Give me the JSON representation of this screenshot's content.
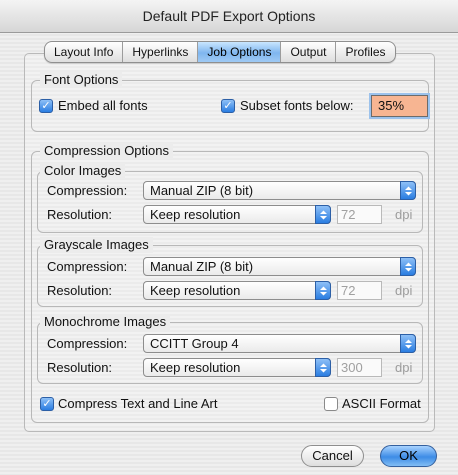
{
  "window": {
    "title": "Default PDF Export Options"
  },
  "tabs": [
    {
      "label": "Layout Info",
      "active": false
    },
    {
      "label": "Hyperlinks",
      "active": false
    },
    {
      "label": "Job Options",
      "active": true
    },
    {
      "label": "Output",
      "active": false
    },
    {
      "label": "Profiles",
      "active": false
    }
  ],
  "font_options": {
    "legend": "Font Options",
    "embed_label": "Embed all fonts",
    "embed_checked": true,
    "subset_label": "Subset fonts below:",
    "subset_checked": true,
    "subset_value": "35%"
  },
  "compression_options": {
    "legend": "Compression Options",
    "color": {
      "legend": "Color Images",
      "compression_label": "Compression:",
      "compression_value": "Manual ZIP (8 bit)",
      "resolution_label": "Resolution:",
      "resolution_value": "Keep resolution",
      "dpi_value": "72",
      "dpi_unit": "dpi"
    },
    "grayscale": {
      "legend": "Grayscale Images",
      "compression_label": "Compression:",
      "compression_value": "Manual ZIP (8 bit)",
      "resolution_label": "Resolution:",
      "resolution_value": "Keep resolution",
      "dpi_value": "72",
      "dpi_unit": "dpi"
    },
    "monochrome": {
      "legend": "Monochrome Images",
      "compression_label": "Compression:",
      "compression_value": "CCITT Group 4",
      "resolution_label": "Resolution:",
      "resolution_value": "Keep resolution",
      "dpi_value": "300",
      "dpi_unit": "dpi"
    }
  },
  "compress_text": {
    "label": "Compress Text and Line Art",
    "checked": true
  },
  "ascii_format": {
    "label": "ASCII Format",
    "checked": false
  },
  "buttons": {
    "cancel": "Cancel",
    "ok": "OK"
  },
  "colors": {
    "accent": "#2a7de1",
    "field_highlight": "#f7b592"
  }
}
